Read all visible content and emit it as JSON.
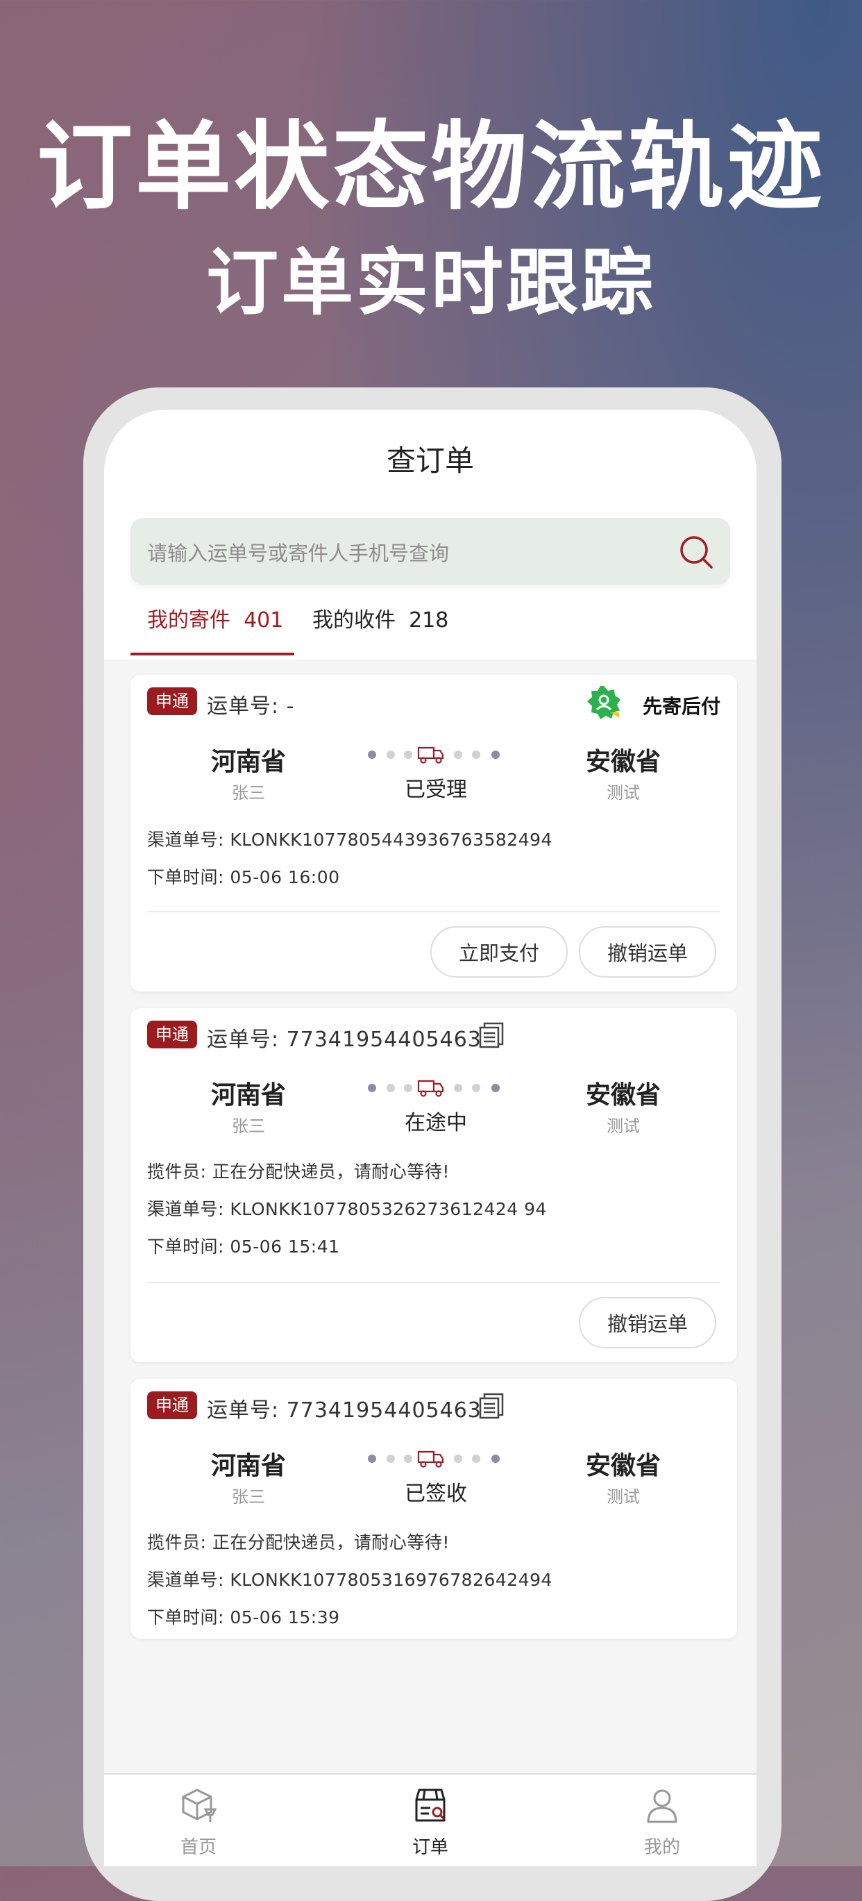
{
  "promo": {
    "title": "订单状态物流轨迹",
    "subtitle": "订单实时跟踪"
  },
  "header": {
    "title": "查订单"
  },
  "search": {
    "placeholder": "请输入运单号或寄件人手机号查询"
  },
  "tabs": [
    {
      "label": "我的寄件",
      "count": "401",
      "active": true
    },
    {
      "label": "我的收件",
      "count": "218",
      "active": false
    }
  ],
  "orders": [
    {
      "badge": "申通",
      "waybill_label": "运单号:",
      "waybill_no": "-",
      "pay_later": "先寄后付",
      "from_province": "河南省",
      "from_person": "张三",
      "to_province": "安徽省",
      "to_person": "测试",
      "status": "已受理",
      "channel_label": "渠道单号:",
      "channel_no": "KLONKK1077805443936763582494",
      "time_label": "下单时间:",
      "time": "05-06 16:00",
      "buttons": [
        "立即支付",
        "撤销运单"
      ]
    },
    {
      "badge": "申通",
      "waybill_label": "运单号:",
      "waybill_no": "773419544054635",
      "from_province": "河南省",
      "from_person": "张三",
      "to_province": "安徽省",
      "to_person": "测试",
      "status": "在途中",
      "courier_label": "揽件员:",
      "courier": "正在分配快递员，请耐心等待!",
      "channel_label": "渠道单号:",
      "channel_no": "KLONKK1077805326273612424 94",
      "time_label": "下单时间:",
      "time": "05-06 15:41",
      "buttons": [
        "撤销运单"
      ]
    },
    {
      "badge": "申通",
      "waybill_label": "运单号:",
      "waybill_no": "773419544054635",
      "from_province": "河南省",
      "from_person": "张三",
      "to_province": "安徽省",
      "to_person": "测试",
      "status": "已签收",
      "courier_label": "揽件员:",
      "courier": "正在分配快递员，请耐心等待!",
      "channel_label": "渠道单号:",
      "channel_no": "KLONKK1077805316976782642494",
      "time_label": "下单时间:",
      "time": "05-06 15:39"
    }
  ],
  "bottom_nav": [
    {
      "label": "首页",
      "icon": "home-box-icon",
      "active": false
    },
    {
      "label": "订单",
      "icon": "order-store-icon",
      "active": true
    },
    {
      "label": "我的",
      "icon": "user-icon",
      "active": false
    }
  ],
  "colors": {
    "accent": "#a31b22",
    "badge": "#9b1b1f",
    "pay_later_green": "#2bb24c"
  }
}
